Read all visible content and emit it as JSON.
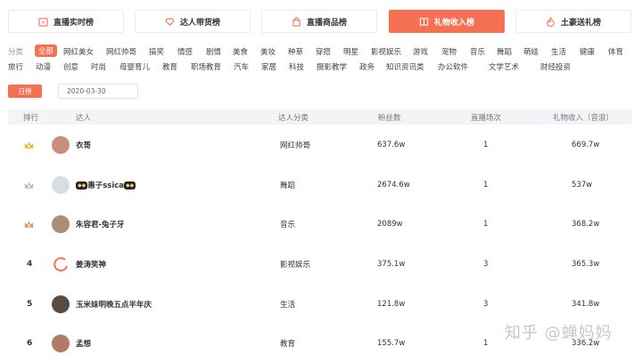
{
  "tabs": [
    {
      "label": "直播实时榜",
      "icon": "play-calendar-icon",
      "active": false
    },
    {
      "label": "达人带货榜",
      "icon": "heart-hand-icon",
      "active": false
    },
    {
      "label": "直播商品榜",
      "icon": "shopping-bag-icon",
      "active": false
    },
    {
      "label": "礼物收入榜",
      "icon": "book-icon",
      "active": true
    },
    {
      "label": "土豪送礼榜",
      "icon": "flame-icon",
      "active": false
    }
  ],
  "categories": {
    "label": "分类",
    "row1": [
      "全部",
      "网红美女",
      "网红帅哥",
      "搞笑",
      "情感",
      "剧情",
      "美食",
      "美妆",
      "种草",
      "穿搭",
      "明星",
      "影视娱乐",
      "游戏",
      "宠物",
      "音乐",
      "舞蹈",
      "萌娃",
      "生活",
      "健康",
      "体育"
    ],
    "row2": [
      "旅行",
      "动漫",
      "创意",
      "时尚",
      "母婴育儿",
      "教育",
      "职场教育",
      "汽车",
      "家居",
      "科技",
      "摄影教学",
      "政务",
      "知识资讯类",
      "办公软件",
      "文学艺术",
      "财经投资"
    ],
    "selected": "全部"
  },
  "filters": {
    "period": "日榜",
    "date": "2020-03-30"
  },
  "table": {
    "headers": {
      "rank": "排行",
      "name": "达人",
      "category": "达人分类",
      "fans": "粉丝数",
      "sessions": "直播场次",
      "income": "礼物收入（音浪）"
    },
    "rows": [
      {
        "rank": "",
        "badge": "gold-crown-icon",
        "name": "衣哥",
        "category": "网红帅哥",
        "fans": "637.6w",
        "sessions": "1",
        "income": "669.7w"
      },
      {
        "rank": "",
        "badge": "silver-crown-icon",
        "name": "惠子ssica",
        "category": "舞蹈",
        "fans": "2674.6w",
        "sessions": "1",
        "income": "537w"
      },
      {
        "rank": "",
        "badge": "bronze-crown-icon",
        "name": "朱容君-兔子牙",
        "category": "音乐",
        "fans": "2089w",
        "sessions": "1",
        "income": "368.2w"
      },
      {
        "rank": "4",
        "badge": "",
        "name": "姜涛笑神",
        "category": "影视娱乐",
        "fans": "375.1w",
        "sessions": "3",
        "income": "365.3w"
      },
      {
        "rank": "5",
        "badge": "",
        "name": "玉米妹明晚五点半年庆",
        "category": "生活",
        "fans": "121.8w",
        "sessions": "3",
        "income": "341.8w"
      },
      {
        "rank": "6",
        "badge": "",
        "name": "孟想",
        "category": "教育",
        "fans": "155.7w",
        "sessions": "1",
        "income": "336.2w"
      }
    ]
  },
  "colors": {
    "accent": "#f47153",
    "gold": "#f2b233",
    "silver": "#b6bcc6",
    "bronze": "#d99a52"
  },
  "watermark": "知乎 @蝉妈妈"
}
